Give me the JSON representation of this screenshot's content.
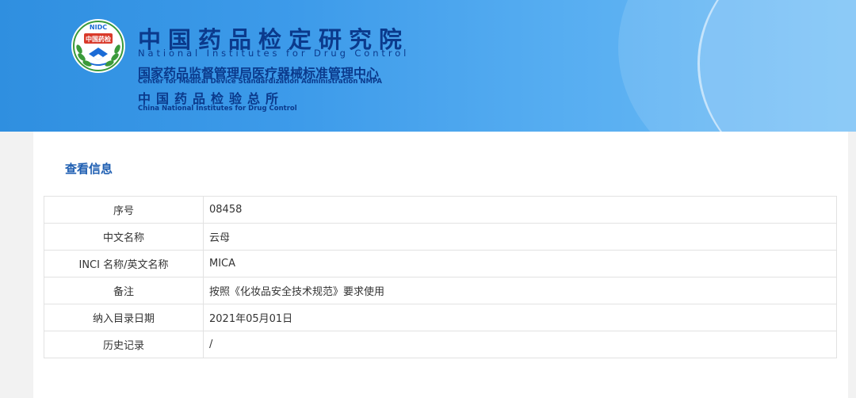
{
  "header": {
    "logo_text": "中国药检",
    "logo_acronym": "NIDC",
    "title_cn": "中国药品检定研究院",
    "title_en": "National Institutes for Drug Control",
    "center_cn": "国家药品监督管理局医疗器械标准管理中心",
    "center_en": "Center for Medical Device Standardization Administration NMPA",
    "institute_cn": "中国药品检验总所",
    "institute_en": "China National Institutes for Drug Control",
    "colors": {
      "banner_start": "#2f8fe0",
      "banner_end": "#6fbdf6",
      "title_text": "#0b3a8c"
    }
  },
  "section": {
    "title": "查看信息",
    "title_color": "#1f5fb2"
  },
  "info_rows": [
    {
      "label": "序号",
      "value": "08458"
    },
    {
      "label": "中文名称",
      "value": "云母"
    },
    {
      "label": "INCI 名称/英文名称",
      "value": "MICA"
    },
    {
      "label": "备注",
      "value": "按照《化妆品安全技术规范》要求使用"
    },
    {
      "label": "纳入目录日期",
      "value": "2021年05月01日"
    },
    {
      "label": "历史记录",
      "value": "/"
    }
  ]
}
